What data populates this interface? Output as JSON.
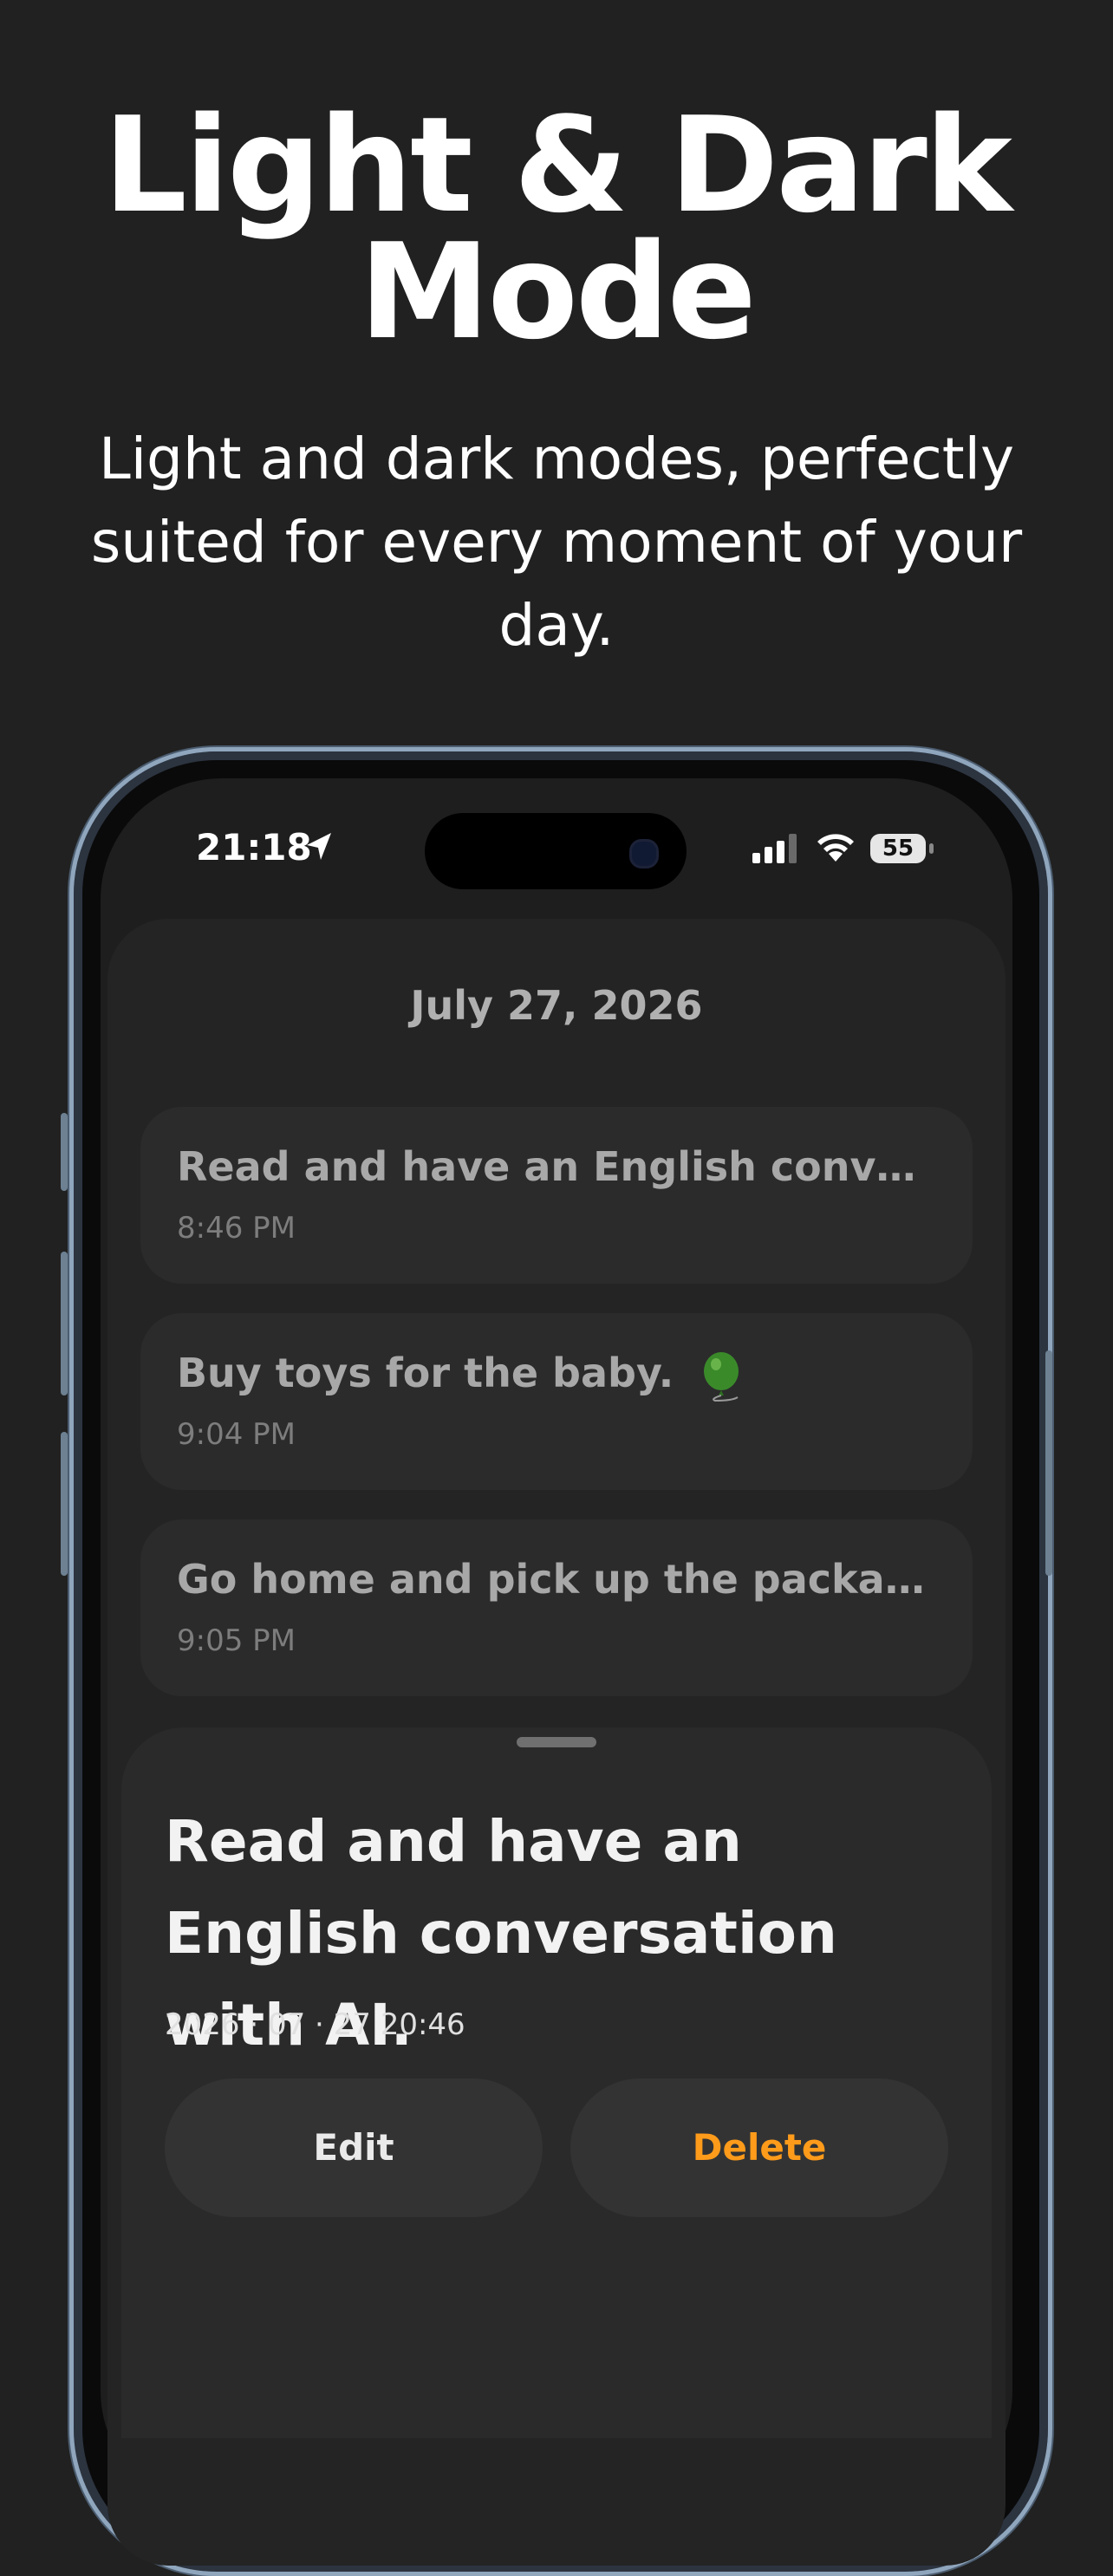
{
  "hero": {
    "title_line1": "Light & Dark",
    "title_line2": "Mode",
    "subtitle": "Light and dark modes, perfectly suited for every moment of your day."
  },
  "status_bar": {
    "time": "21:18",
    "battery": "55",
    "icons": [
      "location-arrow-icon",
      "cellular-signal-icon",
      "wifi-icon",
      "battery-icon"
    ]
  },
  "list": {
    "date": "July 27, 2026",
    "items": [
      {
        "title": "Read and have an English conversation with AI.",
        "time": "8:46 PM"
      },
      {
        "title": "Buy toys for the baby.",
        "time": "9:04 PM",
        "emoji": "balloon-icon"
      },
      {
        "title": "Go home and pick up the package.",
        "time": "9:05 PM"
      }
    ]
  },
  "detail_sheet": {
    "title": "Read and have an English conversation with AI.",
    "timestamp": "2026 · 07 · 27 20:46",
    "edit_label": "Edit",
    "delete_label": "Delete"
  },
  "colors": {
    "background": "#212121",
    "delete_accent": "#ff9b1a",
    "card": "#2b2b2b"
  }
}
